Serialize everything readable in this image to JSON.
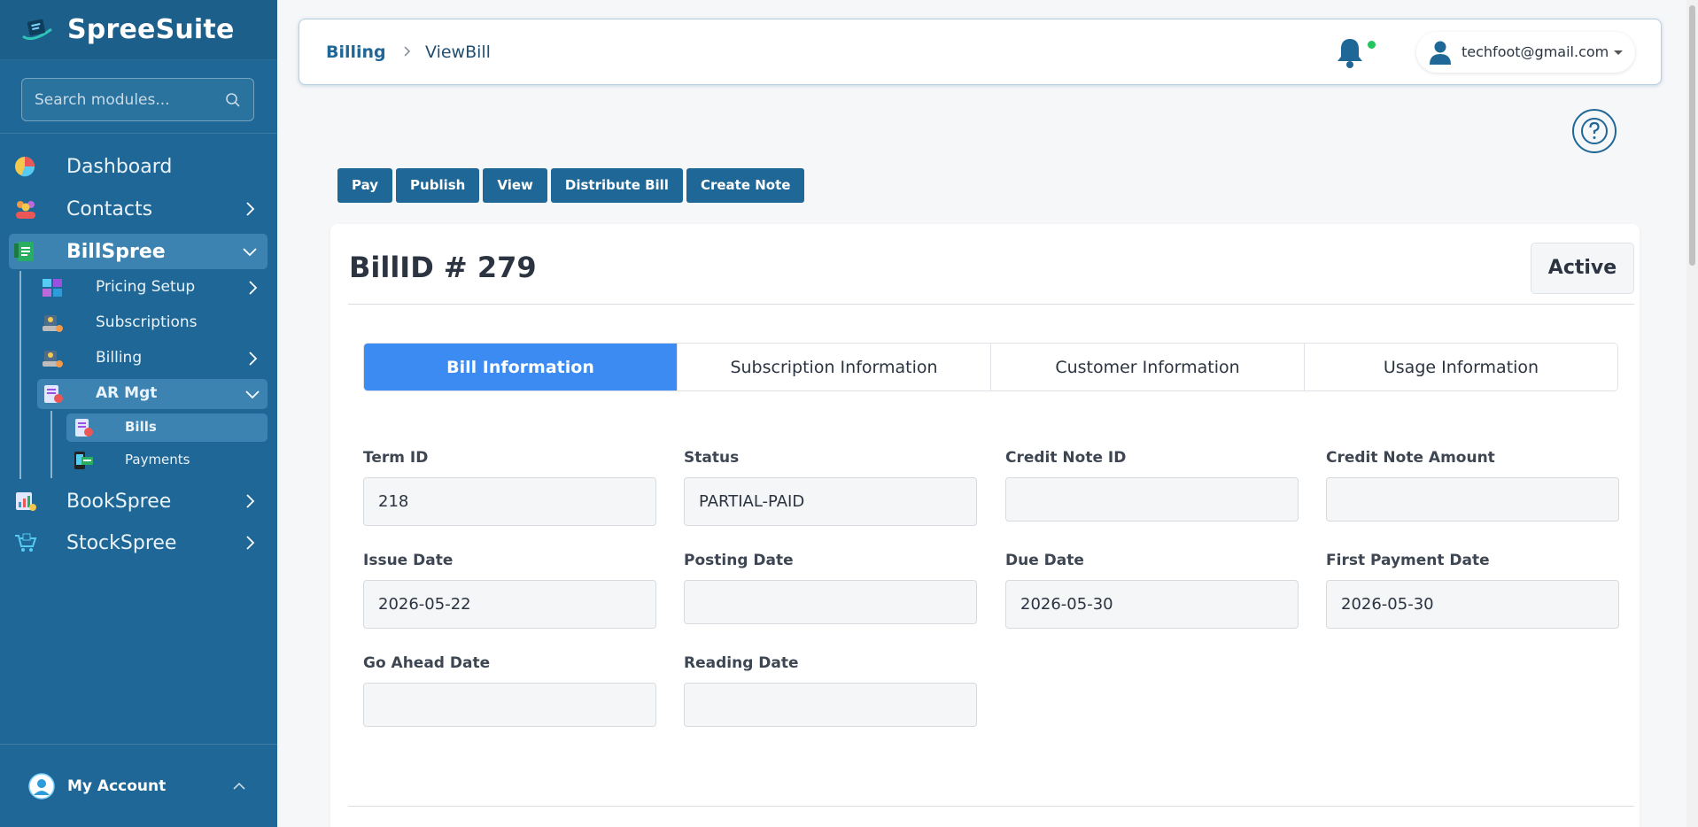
{
  "brand": {
    "name": "SpreeSuite"
  },
  "search": {
    "placeholder": "Search modules..."
  },
  "sidebar": {
    "items": [
      {
        "label": "Dashboard"
      },
      {
        "label": "Contacts"
      },
      {
        "label": "BillSpree"
      },
      {
        "label": "BookSpree"
      },
      {
        "label": "StockSpree"
      }
    ],
    "billspree_sub": [
      {
        "label": "Pricing Setup"
      },
      {
        "label": "Subscriptions"
      },
      {
        "label": "Billing"
      },
      {
        "label": "AR Mgt"
      }
    ],
    "ar_sub": [
      {
        "label": "Bills"
      },
      {
        "label": "Payments"
      }
    ],
    "account_label": "My Account"
  },
  "header": {
    "breadcrumb": [
      "Billing",
      "ViewBill"
    ],
    "user_email": "techfoot@gmail.com"
  },
  "actions": [
    "Pay",
    "Publish",
    "View",
    "Distribute Bill",
    "Create Note"
  ],
  "bill": {
    "title": "BillID # 279",
    "status_chip": "Active"
  },
  "tabs": [
    "Bill Information",
    "Subscription Information",
    "Customer Information",
    "Usage Information"
  ],
  "fields": {
    "term_id": {
      "label": "Term ID",
      "value": "218"
    },
    "status": {
      "label": "Status",
      "value": "PARTIAL-PAID"
    },
    "credit_note_id": {
      "label": "Credit Note ID",
      "value": ""
    },
    "credit_note_amount": {
      "label": "Credit Note Amount",
      "value": ""
    },
    "issue_date": {
      "label": "Issue Date",
      "value": "2026-05-22"
    },
    "posting_date": {
      "label": "Posting Date",
      "value": ""
    },
    "due_date": {
      "label": "Due Date",
      "value": "2026-05-30"
    },
    "first_payment_date": {
      "label": "First Payment Date",
      "value": "2026-05-30"
    },
    "go_ahead_date": {
      "label": "Go Ahead Date",
      "value": ""
    },
    "reading_date": {
      "label": "Reading Date",
      "value": ""
    }
  },
  "colors": {
    "sidebar": "#1f6796",
    "accent": "#3b8bf3",
    "button": "#1f6796",
    "notification_dot": "#22c55e"
  },
  "icons": [
    "search-icon",
    "pie-chart-icon",
    "contacts-icon",
    "spreadsheet-icon",
    "pricing-icon",
    "subscriptions-icon",
    "billing-icon",
    "ar-icon",
    "bills-icon",
    "payments-icon",
    "bookspree-icon",
    "stockspree-icon",
    "user-circle-icon",
    "bell-icon",
    "user-icon",
    "help-icon"
  ]
}
